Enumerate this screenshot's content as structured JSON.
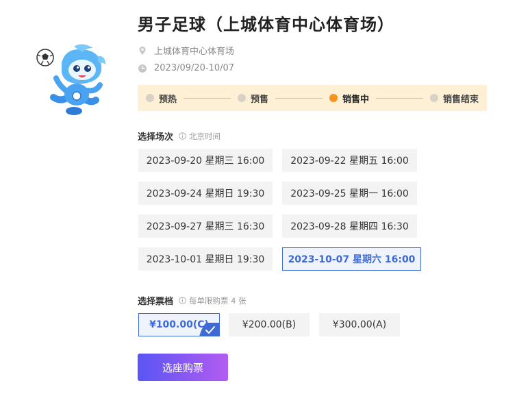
{
  "event": {
    "title": "男子足球（上城体育中心体育场）",
    "venue": "上城体育中心体育场",
    "dates": "2023/09/20-10/07"
  },
  "progress": {
    "steps": [
      {
        "label": "预热",
        "active": false
      },
      {
        "label": "预售",
        "active": false
      },
      {
        "label": "销售中",
        "active": true
      },
      {
        "label": "销售结束",
        "active": false
      }
    ]
  },
  "sessions": {
    "title": "选择场次",
    "note": "北京时间",
    "items": [
      {
        "label": "2023-09-20 星期三 16:00",
        "selected": false
      },
      {
        "label": "2023-09-22 星期五 16:00",
        "selected": false
      },
      {
        "label": "2023-09-24 星期日 19:30",
        "selected": false
      },
      {
        "label": "2023-09-25 星期一 16:00",
        "selected": false
      },
      {
        "label": "2023-09-27 星期三 16:30",
        "selected": false
      },
      {
        "label": "2023-09-28 星期四 16:30",
        "selected": false
      },
      {
        "label": "2023-10-01 星期日 19:30",
        "selected": false
      },
      {
        "label": "2023-10-07 星期六 16:00",
        "selected": true
      }
    ]
  },
  "tickets": {
    "title": "选择票档",
    "note": "每单限购票 4 张",
    "tiers": [
      {
        "label": "¥100.00(C)",
        "selected": true
      },
      {
        "label": "¥200.00(B)",
        "selected": false
      },
      {
        "label": "¥300.00(A)",
        "selected": false
      }
    ]
  },
  "buy_button": "选座购票",
  "colors": {
    "accent": "#3c6bd8",
    "active_step": "#f79320",
    "progress_bg": "#fdf0d5",
    "button_gradient_start": "#5a55f4",
    "button_gradient_end": "#b25cf0"
  },
  "icons": {
    "venue": "map-pin-icon",
    "date": "clock-icon",
    "info": "info-circle-icon",
    "selected": "checkmark-icon"
  }
}
